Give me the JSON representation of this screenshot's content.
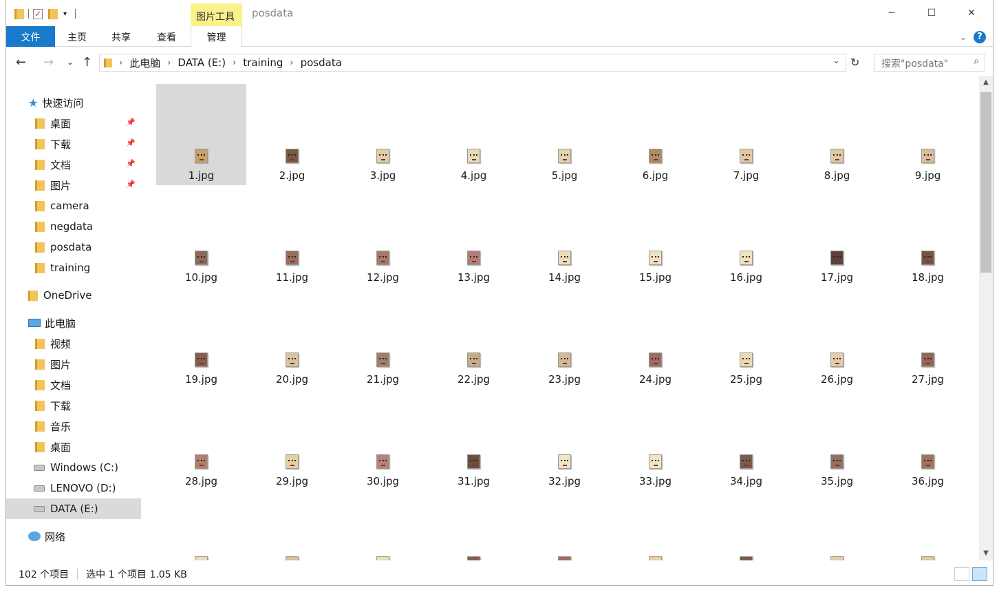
{
  "window": {
    "title": "posdata",
    "context_tab": "图片工具"
  },
  "window_controls": {
    "minimize": "─",
    "maximize": "☐",
    "close": "✕"
  },
  "ribbon": {
    "tabs": [
      "文件",
      "主页",
      "共享",
      "查看",
      "管理"
    ],
    "help": "?"
  },
  "nav": {
    "back": "←",
    "forward": "→",
    "recent": "⌄",
    "up": "↑",
    "refresh": "↻",
    "dropdown": "⌄"
  },
  "address": {
    "crumbs": [
      "此电脑",
      "DATA (E:)",
      "training",
      "posdata"
    ]
  },
  "search": {
    "placeholder": "搜索\"posdata\"",
    "icon": "search-icon"
  },
  "sidebar": {
    "quick_access": "快速访问",
    "quick_items": [
      {
        "label": "桌面",
        "pinned": true
      },
      {
        "label": "下载",
        "pinned": true
      },
      {
        "label": "文档",
        "pinned": true
      },
      {
        "label": "图片",
        "pinned": true
      },
      {
        "label": "camera",
        "pinned": false
      },
      {
        "label": "negdata",
        "pinned": false
      },
      {
        "label": "posdata",
        "pinned": false
      },
      {
        "label": "training",
        "pinned": false
      }
    ],
    "onedrive": "OneDrive",
    "this_pc": "此电脑",
    "pc_items": [
      "视频",
      "图片",
      "文档",
      "下载",
      "音乐",
      "桌面"
    ],
    "drives": [
      "Windows (C:)",
      "LENOVO (D:)",
      "DATA (E:)"
    ],
    "selected_drive": "DATA (E:)",
    "network": "网络"
  },
  "files": [
    "1.jpg",
    "2.jpg",
    "3.jpg",
    "4.jpg",
    "5.jpg",
    "6.jpg",
    "7.jpg",
    "8.jpg",
    "9.jpg",
    "10.jpg",
    "11.jpg",
    "12.jpg",
    "13.jpg",
    "14.jpg",
    "15.jpg",
    "16.jpg",
    "17.jpg",
    "18.jpg",
    "19.jpg",
    "20.jpg",
    "21.jpg",
    "22.jpg",
    "23.jpg",
    "24.jpg",
    "25.jpg",
    "26.jpg",
    "27.jpg",
    "28.jpg",
    "29.jpg",
    "30.jpg",
    "31.jpg",
    "32.jpg",
    "33.jpg",
    "34.jpg",
    "35.jpg",
    "36.jpg"
  ],
  "selected_file": "1.jpg",
  "thumb_colors": [
    "#c9a06a",
    "#7a5a44",
    "#e0cfa6",
    "#e8dcb4",
    "#e6d3aa",
    "#b08b64",
    "#e2c9a4",
    "#dfc9a0",
    "#d7bf98",
    "#8e6a58",
    "#9a6d5a",
    "#a87866",
    "#b37c74",
    "#ecdcb8",
    "#efe2c0",
    "#eee4bc",
    "#5e4038",
    "#7a5248",
    "#8a5c50",
    "#d8c3a0",
    "#9e8068",
    "#c6ad88",
    "#d2ba94",
    "#a06a62",
    "#e9d8b0",
    "#e4cca6",
    "#956658",
    "#b08068",
    "#e6cfa2",
    "#b8827a",
    "#6b5040",
    "#efe4c4",
    "#f0e6c6",
    "#7d5a4c",
    "#94705e",
    "#a3725e"
  ],
  "status": {
    "count": "102 个项目",
    "selection": "选中 1 个项目  1.05 KB"
  }
}
